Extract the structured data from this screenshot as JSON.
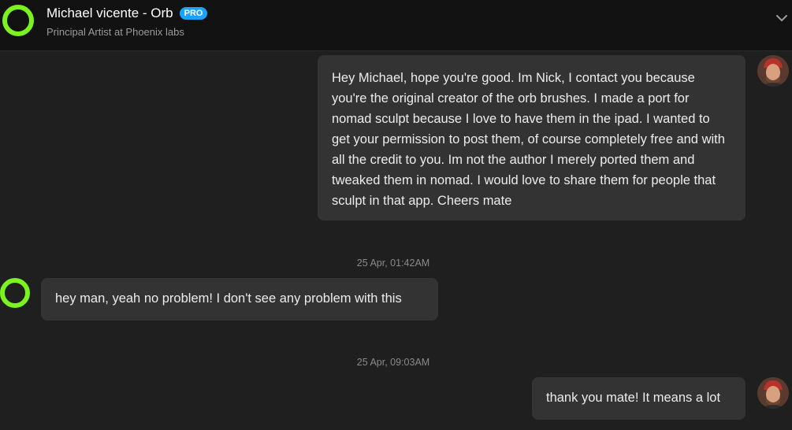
{
  "header": {
    "name": "Michael vicente - Orb",
    "badge": "PRO",
    "subtitle": "Principal Artist at Phoenix labs",
    "chevron_icon": "chevron-down-icon"
  },
  "messages": [
    {
      "sender": "self",
      "text": "Hey Michael, hope you're good. Im Nick, I contact you because you're the original creator of the orb brushes. I made a port for nomad sculpt because I love to have them in the ipad. I wanted to get your permission to post them, of course completely free and with all the credit to you. Im not the author I merely ported them and tweaked them in nomad. I would love to share them for people that sculpt in that app. Cheers mate"
    },
    {
      "timestamp": "25 Apr, 01:42AM",
      "sender": "other",
      "text": "hey man, yeah no problem! I don't see any problem with this"
    },
    {
      "timestamp": "25 Apr, 09:03AM",
      "sender": "self",
      "text": "thank you mate! It means a lot"
    }
  ],
  "colors": {
    "accent_ring": "#7cf21e",
    "pro_badge": "#1aa3ff",
    "background": "#1f1f1f",
    "header_bg": "#121212",
    "bubble_bg": "#333333"
  }
}
